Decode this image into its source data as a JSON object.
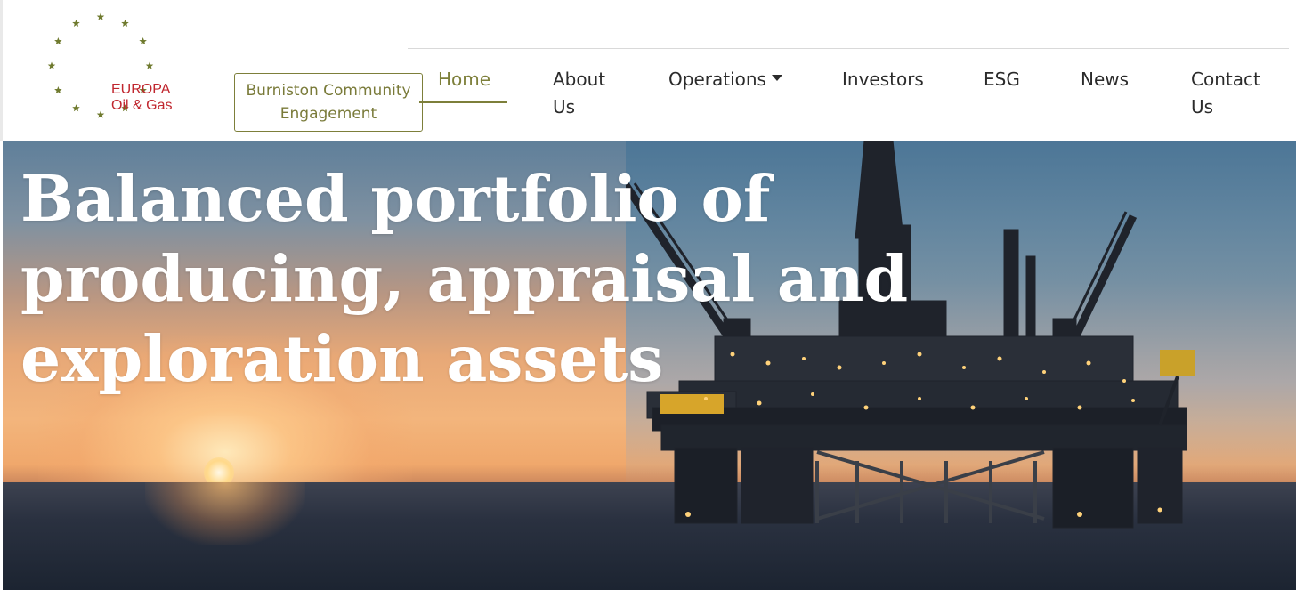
{
  "brand": {
    "line1": "EUROPA",
    "line2": "Oil & Gas",
    "text_color": "#c0262e",
    "star_color": "#6f7a2e"
  },
  "header": {
    "community_button": "Burniston Community Engagement",
    "nav": [
      {
        "label": "Home",
        "active": true
      },
      {
        "label": "About Us",
        "active": false
      },
      {
        "label": "Operations",
        "active": false,
        "has_dropdown": true
      },
      {
        "label": "Investors",
        "active": false
      },
      {
        "label": "ESG",
        "active": false
      },
      {
        "label": "News",
        "active": false
      },
      {
        "label": "Contact Us",
        "active": false
      }
    ],
    "accent_color": "#7d7f3a"
  },
  "hero": {
    "title": "Balanced portfolio of producing, appraisal and exploration assets",
    "image_alt": "offshore-oil-platform-at-sunset"
  }
}
